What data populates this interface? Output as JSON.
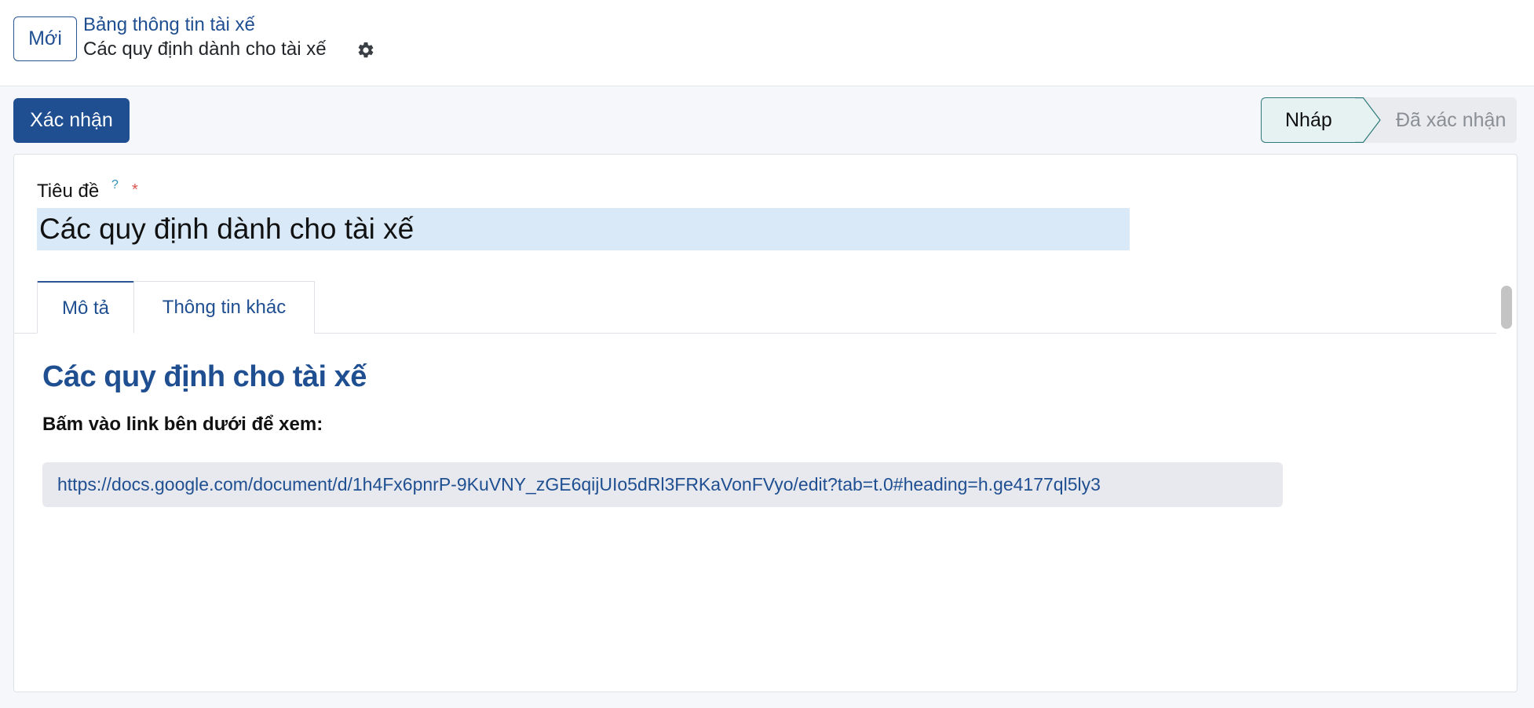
{
  "header": {
    "new_button": "Mới",
    "breadcrumb_parent": "Bảng thông tin tài xế",
    "breadcrumb_current": "Các quy định dành cho tài xế",
    "settings_icon": "gear-icon"
  },
  "actions": {
    "confirm_button": "Xác nhận"
  },
  "statusbar": {
    "stages": [
      "Nháp",
      "Đã xác nhận"
    ],
    "active": "Nháp"
  },
  "form": {
    "title_label": "Tiêu đề",
    "help_mark": "?",
    "required_mark": "*",
    "title_value": "Các quy định dành cho tài xế"
  },
  "tabs": {
    "items": [
      "Mô tả",
      "Thông tin khác"
    ],
    "active": "Mô tả"
  },
  "description": {
    "heading": "Các quy định cho tài xế",
    "subheading": "Bấm vào link bên dưới để xem:",
    "link": "https://docs.google.com/document/d/1h4Fx6pnrP-9KuVNY_zGE6qijUIo5dRl3FRKaVonFVyo/edit?tab=t.0#heading=h.ge4177ql5ly3"
  },
  "colors": {
    "brand": "#1f4f91",
    "active_stage_bg": "#e6f2f2",
    "input_highlight": "#d9e9f7"
  }
}
